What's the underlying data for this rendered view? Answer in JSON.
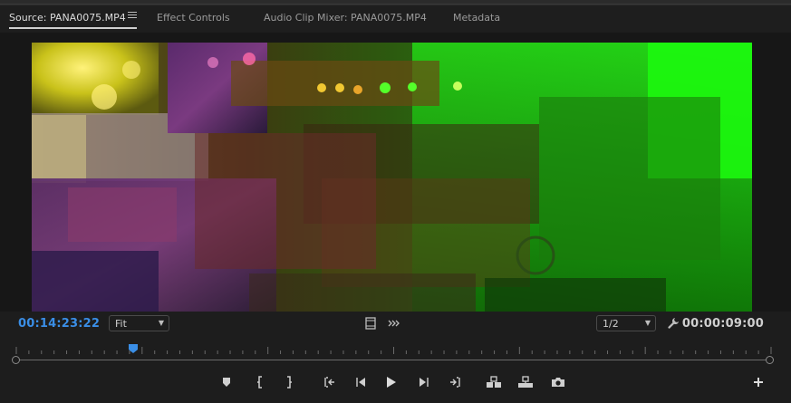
{
  "tabs": [
    {
      "label": "Source: PANA0075.MP4",
      "active": true
    },
    {
      "label": "Effect Controls",
      "active": false
    },
    {
      "label": "Audio Clip Mixer: PANA0075.MP4",
      "active": false
    },
    {
      "label": "Metadata",
      "active": false
    }
  ],
  "timecode": {
    "current": "00:14:23:22",
    "duration": "00:00:09:00"
  },
  "zoom_select": {
    "value": "Fit"
  },
  "resolution_select": {
    "value": "1/2"
  },
  "playhead": {
    "position_fraction": 0.155
  },
  "colors": {
    "accent": "#3a8ee6",
    "background": "#1d1d1d",
    "text": "#cfcfcf"
  },
  "icons": {
    "panel_menu": "hamburger-icon",
    "overflow": "double-chevron-right-icon",
    "safe_margins": "film-frame-icon",
    "drop_frames": "arrows-icon",
    "settings": "wrench-icon",
    "add_button": "plus-icon"
  },
  "transport_buttons": [
    "add-marker",
    "mark-in",
    "mark-out",
    "go-to-in",
    "step-back",
    "play",
    "step-forward",
    "go-to-out",
    "insert",
    "overwrite",
    "export-frame"
  ]
}
